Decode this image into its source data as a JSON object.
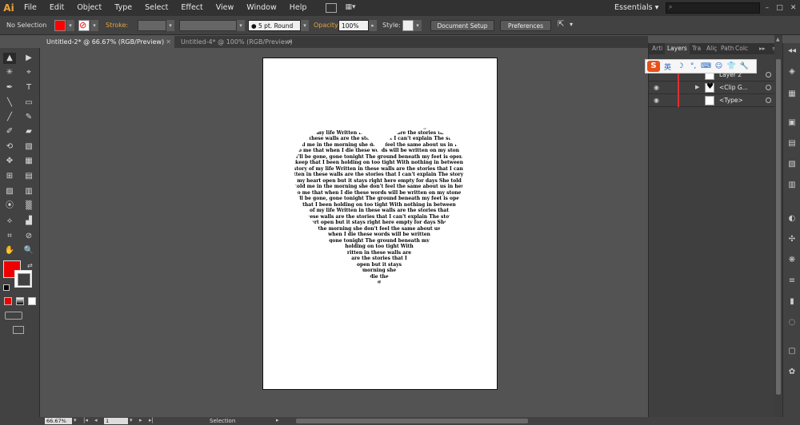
{
  "app": {
    "logo": "Ai"
  },
  "menu": [
    "File",
    "Edit",
    "Object",
    "Type",
    "Select",
    "Effect",
    "View",
    "Window",
    "Help"
  ],
  "workspace": {
    "label": "Essentials",
    "arrow": "▾"
  },
  "window_controls": [
    "–",
    "□",
    "✕"
  ],
  "control_bar": {
    "selection": "No Selection",
    "fill_color": "#ff0000",
    "stroke_label": "Stroke:",
    "brush": "5 pt. Round",
    "opacity_label": "Opacity:",
    "opacity_value": "100%",
    "style_label": "Style:",
    "doc_setup": "Document Setup",
    "preferences": "Preferences"
  },
  "tabs": [
    {
      "label": "Untitled-2* @ 66.67% (RGB/Preview)",
      "close": "✕"
    },
    {
      "label": "Untitled-4* @ 100% (RGB/Preview)",
      "close": "✕"
    }
  ],
  "tools": [
    "▲",
    "▶",
    "✳",
    "⌖",
    "✒",
    "T",
    "╲",
    "▭",
    "╱",
    "✎",
    "✐",
    "▰",
    "⟲",
    "▧",
    "✥",
    "▦",
    "⊞",
    "▤",
    "▨",
    "▥",
    "⦿",
    "▒",
    "⟡",
    "▟",
    "⌗",
    "⊘",
    "✋",
    "🔍"
  ],
  "panel": {
    "tabs": [
      "Arti",
      "Layers",
      "Tra",
      "Aliç",
      "Path",
      "Colc"
    ],
    "layers": [
      {
        "name": "Layer 2"
      },
      {
        "name": "<Clip G..."
      },
      {
        "name": "<Type>"
      }
    ]
  },
  "ime": {
    "logo": "S",
    "items": [
      "英",
      "☽",
      "°,",
      "⌨",
      "☺",
      "👕",
      "🔧"
    ]
  },
  "status": {
    "zoom": "66.67%",
    "page": "1",
    "text": "Selection"
  },
  "artwork": {
    "lines": [
      "t been holding on too tight With nothing in be",
      "of my life Written in these walls are the stories that",
      "in these walls are the stories that I can't explain The stor",
      "told me in the morning she don't feel the same about us in her",
      "to me that when I die these words will be written on my stone",
      "I'll be gone, gone tonight The ground beneath my feet is open",
      "keep that I been holding on too tight With nothing in between",
      "story of my life Written in these walls are the stories that I can't",
      "tten in these walls are the stories that I can't explain The story of",
      "my heart open but it stays right here empty for days She told",
      "told me in the morning she don't feel the same about us in her",
      "o me that when I die these words will be written on my stone",
      "I'll be gone, gone tonight The ground beneath my feet is open",
      "that I been holding on too tight With nothing in between",
      "of my life Written in these walls are the stories that",
      "these walls are the stories that I can't explain The story",
      "art open but it stays right here empty for days She",
      "the morning she don't feel the same about us",
      "when I die these words will be written",
      "gone tonight The ground beneath my",
      "holding on too tight With",
      "ritten in these walls are",
      "are the stories that I",
      "open but it stays",
      "morning she",
      "die the",
      "g"
    ]
  }
}
